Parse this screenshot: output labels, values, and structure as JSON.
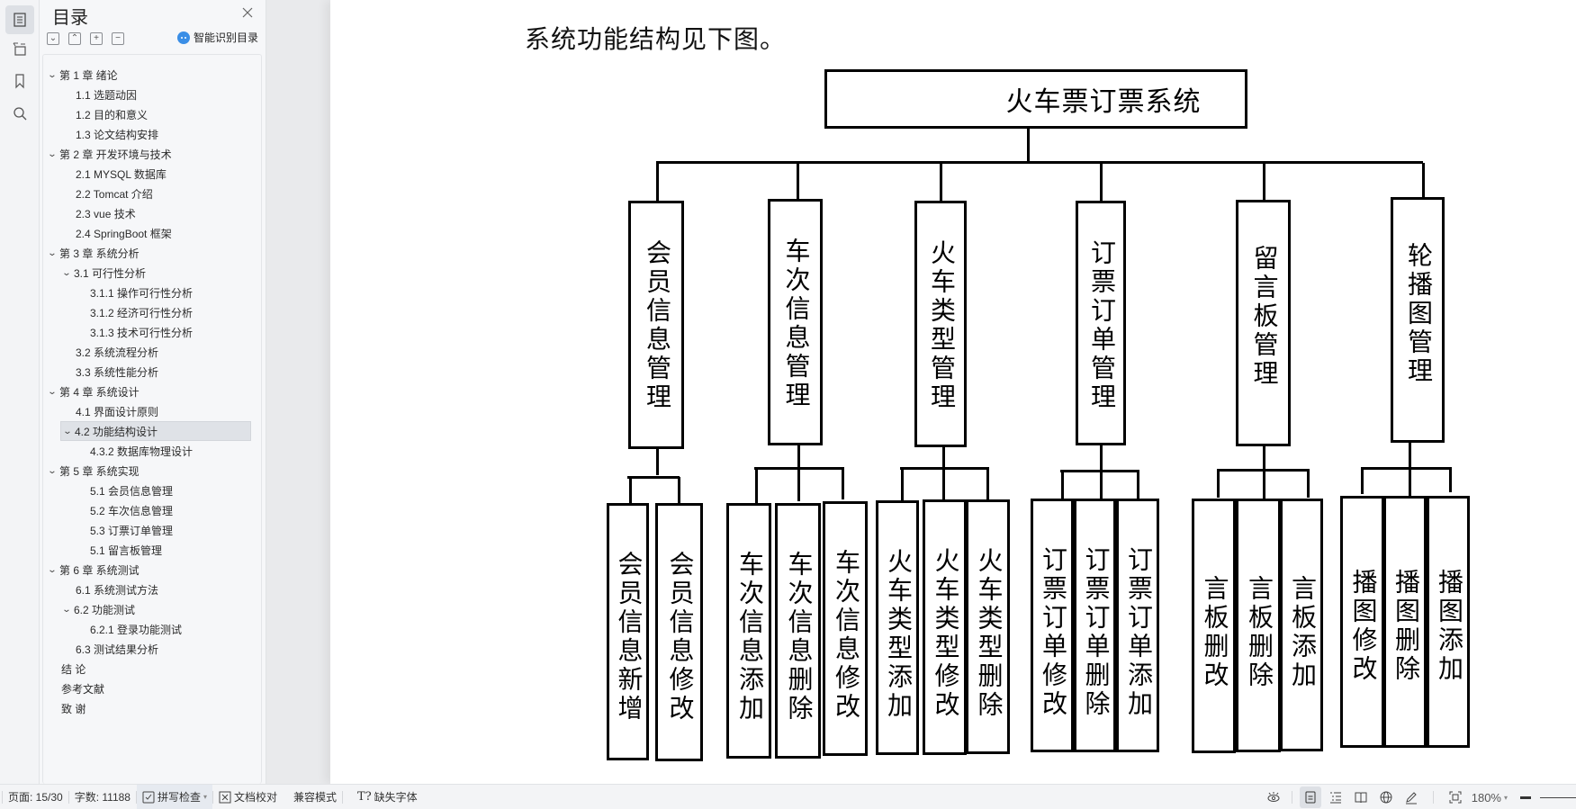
{
  "sidebar_icons": [
    {
      "name": "toc-icon",
      "active": true
    },
    {
      "name": "nav-tree-icon",
      "active": false
    },
    {
      "name": "bookmark-icon",
      "active": false
    },
    {
      "name": "search-icon",
      "active": false
    }
  ],
  "toc": {
    "title": "目录",
    "smart_label": "智能识别目录",
    "tools": [
      "collapse",
      "expand",
      "add",
      "remove"
    ],
    "items": [
      {
        "label": "第 1 章  绪论",
        "level": 0,
        "caret": true
      },
      {
        "label": "1.1 选题动因",
        "level": 1,
        "caret": false
      },
      {
        "label": "1.2 目的和意义",
        "level": 1,
        "caret": false
      },
      {
        "label": "1.3 论文结构安排",
        "level": 1,
        "caret": false
      },
      {
        "label": "第 2 章  开发环境与技术",
        "level": 0,
        "caret": true
      },
      {
        "label": "2.1 MYSQL 数据库",
        "level": 1,
        "caret": false
      },
      {
        "label": "2.2 Tomcat  介绍",
        "level": 1,
        "caret": false
      },
      {
        "label": "2.3 vue 技术",
        "level": 1,
        "caret": false
      },
      {
        "label": "2.4 SpringBoot 框架",
        "level": 1,
        "caret": false
      },
      {
        "label": "第 3 章  系统分析",
        "level": 0,
        "caret": true
      },
      {
        "label": "3.1 可行性分析",
        "level": 1,
        "caret": true
      },
      {
        "label": "3.1.1 操作可行性分析",
        "level": 2,
        "caret": false
      },
      {
        "label": "3.1.2 经济可行性分析",
        "level": 2,
        "caret": false
      },
      {
        "label": "3.1.3 技术可行性分析",
        "level": 2,
        "caret": false
      },
      {
        "label": "3.2 系统流程分析",
        "level": 1,
        "caret": false
      },
      {
        "label": "3.3 系统性能分析",
        "level": 1,
        "caret": false
      },
      {
        "label": "第 4 章  系统设计",
        "level": 0,
        "caret": true
      },
      {
        "label": "4.1 界面设计原则",
        "level": 1,
        "caret": false
      },
      {
        "label": "4.2 功能结构设计",
        "level": 1,
        "caret": true,
        "selected": true
      },
      {
        "label": "4.3.2  数据库物理设计",
        "level": 2,
        "caret": false
      },
      {
        "label": "第 5 章  系统实现",
        "level": 0,
        "caret": true
      },
      {
        "label": "5.1 会员信息管理",
        "level": 2,
        "caret": false
      },
      {
        "label": "5.2  车次信息管理",
        "level": 2,
        "caret": false
      },
      {
        "label": "5.3 订票订单管理",
        "level": 2,
        "caret": false
      },
      {
        "label": "5.1 留言板管理",
        "level": 2,
        "caret": false
      },
      {
        "label": "第 6 章  系统测试",
        "level": 0,
        "caret": true
      },
      {
        "label": "6.1  系统测试方法",
        "level": 1,
        "caret": false
      },
      {
        "label": "6.2  功能测试",
        "level": 1,
        "caret": true
      },
      {
        "label": "6.2.1  登录功能测试",
        "level": 2,
        "caret": false
      },
      {
        "label": "6.3  测试结果分析",
        "level": 1,
        "caret": false
      },
      {
        "label": "结    论",
        "level": 0,
        "caret": false
      },
      {
        "label": "参考文献",
        "level": 0,
        "caret": false
      },
      {
        "label": "致    谢",
        "level": 0,
        "caret": false
      }
    ]
  },
  "document": {
    "intro_text": "系统功能结构见下图。",
    "diagram": {
      "root": "火车票订票系统",
      "modules": [
        {
          "label": "会员信息管理",
          "children": [
            "会员信息新增",
            "会员信息修改"
          ]
        },
        {
          "label": "车次信息管理",
          "children": [
            "车次信息添加",
            "车次信息删除",
            "车次信息修改"
          ]
        },
        {
          "label": "火车类型管理",
          "children": [
            "火车类型添加",
            "火车类型修改",
            "火车类型删除"
          ]
        },
        {
          "label": "订票订单管理",
          "children": [
            "订票订单修改",
            "订票订单删除",
            "订票订单添加"
          ]
        },
        {
          "label": "留言板管理",
          "children": [
            "言板删改",
            "言板删除",
            "言板添加"
          ]
        },
        {
          "label": "轮播图管理",
          "children": [
            "播图修改",
            "播图删除",
            "播图添加"
          ]
        }
      ]
    }
  },
  "statusbar": {
    "page": "页面: 15/30",
    "words": "字数: 11188",
    "spellcheck": "拼写检查",
    "proofread": "文档校对",
    "compat": "兼容模式",
    "missing_font": "缺失字体",
    "zoom": "180%",
    "view_modes": [
      "page-view",
      "outline-view",
      "reading-view",
      "web-view",
      "pen-mode"
    ],
    "active_view": "page-view"
  }
}
